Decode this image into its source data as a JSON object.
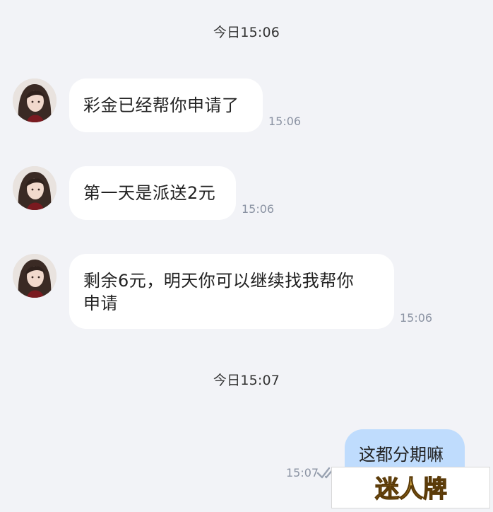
{
  "dividers": [
    {
      "text": "今日15:06"
    },
    {
      "text": "今日15:07"
    }
  ],
  "incoming": [
    {
      "text": "彩金已经帮你申请了",
      "time": "15:06"
    },
    {
      "text": "第一天是派送2元",
      "time": "15:06"
    },
    {
      "line1": "剩余6元，明天你可以继续找我帮你",
      "line2": "申请",
      "time": "15:06"
    }
  ],
  "outgoing": [
    {
      "text": "这都分期嘛",
      "time": "15:07",
      "status_icon": "double-check-icon"
    }
  ],
  "watermark": {
    "text": "迷人牌"
  },
  "colors": {
    "background": "#f2f3f7",
    "incoming_bubble": "#ffffff",
    "outgoing_bubble": "#bfdcfd",
    "timestamp": "#8b93a3",
    "watermark_gold": "#c8962a"
  }
}
